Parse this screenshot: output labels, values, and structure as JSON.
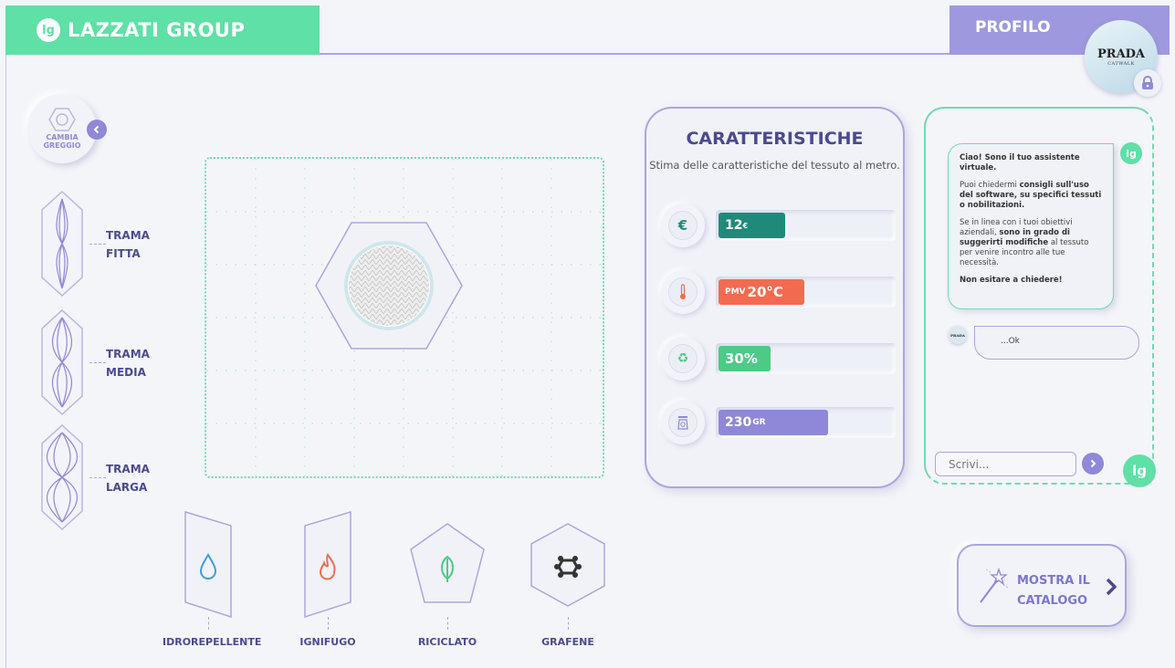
{
  "brand": {
    "logo_text": "lg",
    "name": "LAZZATI GROUP"
  },
  "profile": {
    "label": "PROFILO",
    "avatar_brand": "PRADA",
    "avatar_sub": "CATWALK"
  },
  "yarn": {
    "label_line1": "CAMBIA",
    "label_line2": "GREGGIO"
  },
  "weaves": [
    {
      "line1": "TRAMA",
      "line2": "FITTA"
    },
    {
      "line1": "TRAMA",
      "line2": "MEDIA"
    },
    {
      "line1": "TRAMA",
      "line2": "LARGA"
    }
  ],
  "features": [
    {
      "label": "IDROREPELLENTE",
      "icon": "water-drop-icon"
    },
    {
      "label": "IGNIFUGO",
      "icon": "flame-icon"
    },
    {
      "label": "RICICLATO",
      "icon": "leaf-icon"
    },
    {
      "label": "GRAFENE",
      "icon": "graphene-icon"
    }
  ],
  "characteristics": {
    "title": "CARATTERISTICHE",
    "subtitle": "Stima delle caratteristiche del tessuto al metro.",
    "items": [
      {
        "icon": "euro-icon",
        "value": "12",
        "unit": "€",
        "fill": 0.38,
        "color": "#1f8a7a"
      },
      {
        "icon": "thermometer-icon",
        "prefix": "PMV",
        "value": "20°C",
        "fill": 0.49,
        "color": "#f26b50"
      },
      {
        "icon": "recycle-icon",
        "value": "30%",
        "fill": 0.3,
        "color": "#4ccb86"
      },
      {
        "icon": "scale-icon",
        "value": "230",
        "unit": "GR",
        "fill": 0.63,
        "color": "#8f88d8"
      }
    ]
  },
  "chat": {
    "bot_logo": "lg",
    "bot_msg_p1": "Ciao! Sono il tuo assistente virtuale.",
    "bot_msg_p2_a": "Puoi chiedermi ",
    "bot_msg_p2_b": "consigli sull'uso del software, su specifici tessuti o nobilitazioni.",
    "bot_msg_p3_a": "Se in linea con i tuoi obiettivi aziendali, ",
    "bot_msg_p3_b": "sono in grado di suggerirti modifiche",
    "bot_msg_p3_c": " al tessuto per venire incontro alle tue necessità.",
    "bot_msg_p4": "Non esitare a chiedere!",
    "user_avatar": "PRADA",
    "user_msg": "...Ok",
    "input_placeholder": "Scrivi..."
  },
  "catalog": {
    "line1": "MOSTRA IL",
    "line2": "CATALOGO"
  },
  "colors": {
    "green": "#5ee0a6",
    "purple": "#9e99de",
    "navy": "#4b4a8f"
  }
}
